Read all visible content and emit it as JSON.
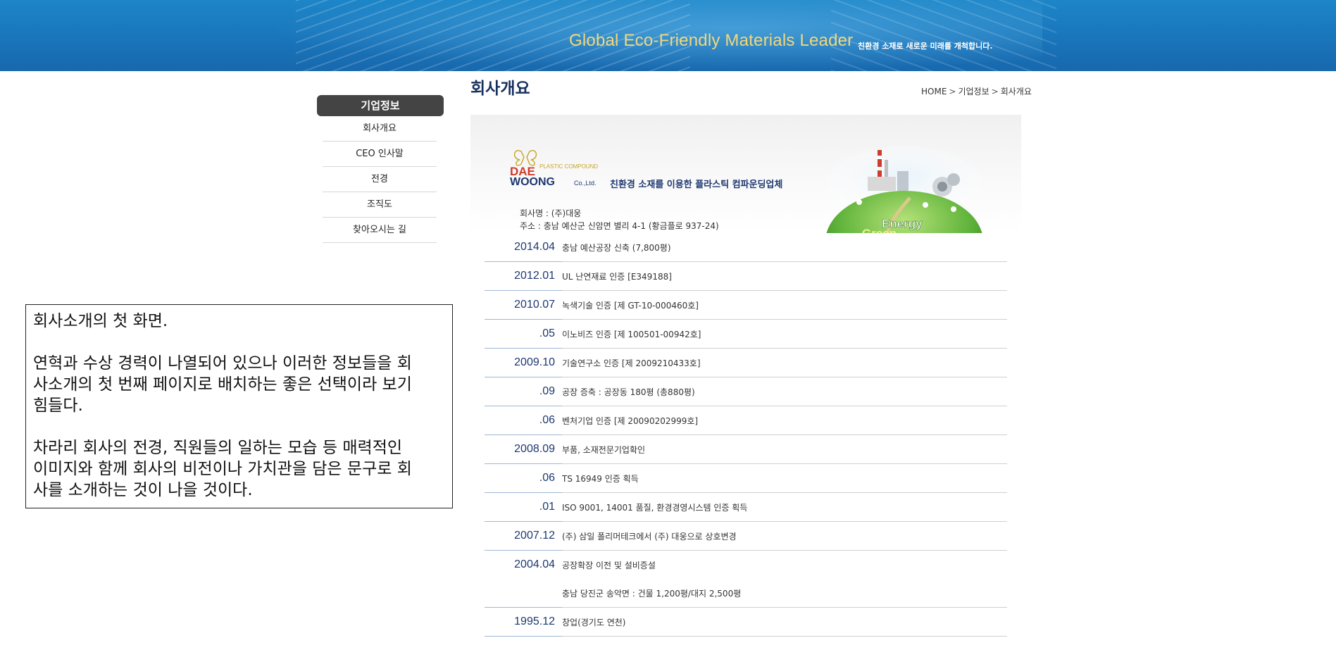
{
  "banner": {
    "slogan": "Global Eco-Friendly Materials Leader",
    "slogan_sub": "친환경 소재로 새로운 미래를 개척합니다."
  },
  "sidebar": {
    "heading": "기업정보",
    "items": [
      {
        "label": "회사개요"
      },
      {
        "label": "CEO 인사말"
      },
      {
        "label": "전경"
      },
      {
        "label": "조직도"
      },
      {
        "label": "찾아오시는 길"
      }
    ]
  },
  "main": {
    "title": "회사개요",
    "breadcrumb": [
      "HOME",
      "기업정보",
      "회사개요"
    ],
    "breadcrumb_sep": ">",
    "hero": {
      "logo_dae": "DAE",
      "logo_woong": "WOONG",
      "logo_co": "Co.,Ltd.",
      "logo_plastic": "PLASTIC COMPOUND",
      "tagline": "친환경 소재를 이용한 플라스틱 컴파운딩업체",
      "company_name": "회사명 : (주)대웅",
      "address": "주소 : 충남 예산군 신암면 별리 4-1 (황금플로 937-24)",
      "globe_text_1": "Energy",
      "globe_text_2": "Green"
    },
    "history": [
      {
        "date": "2014.04",
        "items": [
          "충남 예산공장 신축 (7,800평)"
        ]
      },
      {
        "date": "2012.01",
        "items": [
          "UL 난연재료 인증 [E349188]"
        ]
      },
      {
        "date": "2010.07",
        "items": [
          "녹색기술 인증 [제 GT-10-000460호]"
        ]
      },
      {
        "date": ".05",
        "items": [
          "이노비즈 인증 [제 100501-00942호]"
        ]
      },
      {
        "date": "2009.10",
        "items": [
          "기술연구소 인증 [제 2009210433호]"
        ]
      },
      {
        "date": ".09",
        "items": [
          "공장 증축 : 공장동 180평 (총880평)"
        ]
      },
      {
        "date": ".06",
        "items": [
          "벤처기업 인증 [제 20090202999호]"
        ]
      },
      {
        "date": "2008.09",
        "items": [
          "부품, 소재전문기업확인"
        ]
      },
      {
        "date": ".06",
        "items": [
          "TS 16949 인증 획득"
        ]
      },
      {
        "date": ".01",
        "items": [
          "ISO 9001, 14001 품질, 환경경영시스템 인증 획득"
        ]
      },
      {
        "date": "2007.12",
        "items": [
          "(주) 삼일 폴리머테크에서 (주) 대웅으로 상호변경"
        ]
      },
      {
        "date": "2004.04",
        "items": [
          "공장확장 이전 및 설비증설",
          "충남 당진군 송악면 : 건물 1,200평/대지 2,500평"
        ]
      },
      {
        "date": "1995.12",
        "items": [
          "창업(경기도 연천)"
        ]
      }
    ]
  },
  "annotation": {
    "paragraphs": [
      "회사소개의 첫 화면.",
      "연혁과 수상 경력이 나열되어 있으나 이러한 정보들을 회\n사소개의 첫 번째 페이지로 배치하는 좋은 선택이라 보기\n힘들다.",
      "차라리 회사의 전경, 직원들의 일하는 모습 등 매력적인\n이미지와 함께 회사의 비전이나 가치관을 담은 문구로 회\n사를 소개하는 것이 나을 것이다."
    ]
  },
  "colors": {
    "banner": "#1a78bd",
    "slogan": "#f2d77a",
    "title": "#16305e",
    "date": "#1d3870",
    "sidebar_head": "#444444"
  }
}
